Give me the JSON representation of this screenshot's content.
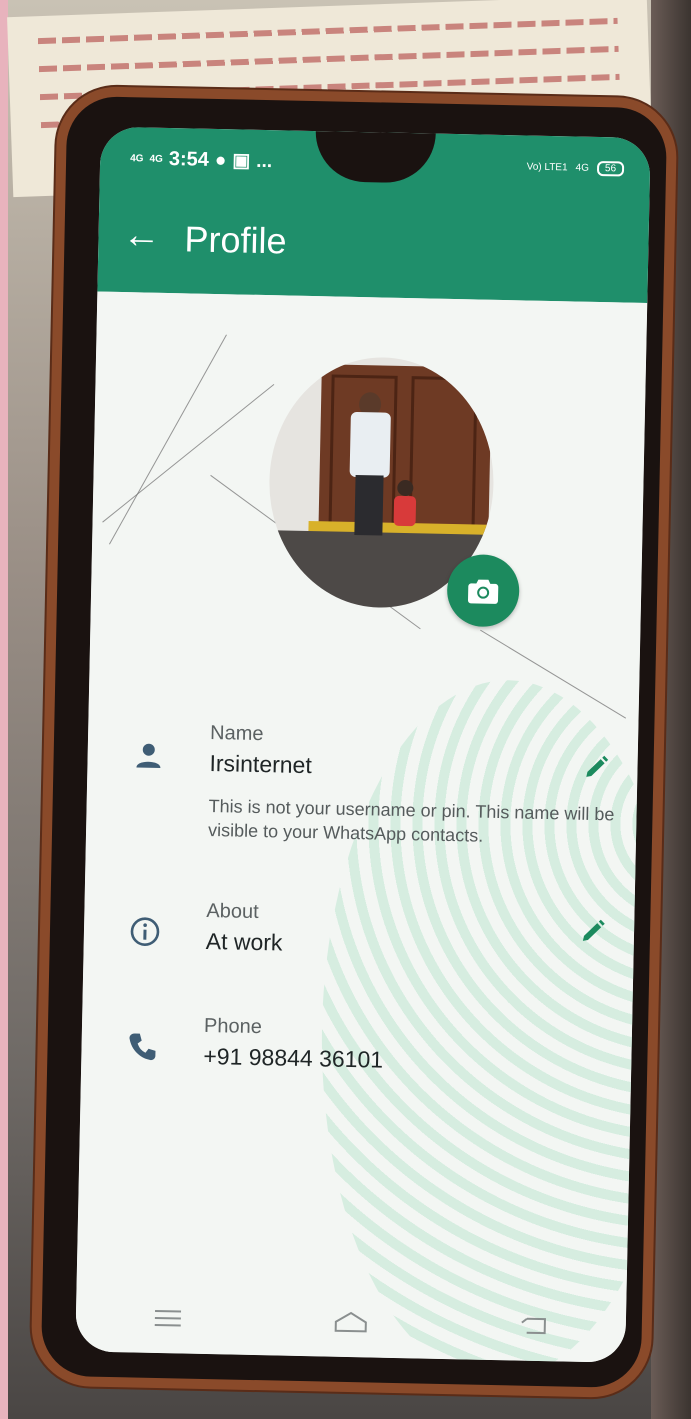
{
  "status_bar": {
    "network_left_1": "4G",
    "network_left_2": "4G",
    "time": "3:54",
    "dots": "...",
    "network_right_1": "Vo)",
    "network_right_2": "LTE1",
    "network_right_3": "4G",
    "battery": "56"
  },
  "app_bar": {
    "back_icon": "arrow-left-icon",
    "title": "Profile"
  },
  "profile": {
    "camera_icon": "camera-icon",
    "name_section": {
      "icon": "person-icon",
      "label": "Name",
      "value": "Irsinternet",
      "hint": "This is not your username or pin. This name will be visible to your WhatsApp contacts.",
      "edit_icon": "pencil-icon"
    },
    "about_section": {
      "icon": "info-icon",
      "label": "About",
      "value": "At work",
      "edit_icon": "pencil-icon"
    },
    "phone_section": {
      "icon": "phone-icon",
      "label": "Phone",
      "value": "+91 98844 36101"
    }
  },
  "nav_bar": {
    "menu_icon": "menu-icon",
    "home_icon": "home-icon",
    "back_icon": "back-icon"
  },
  "colors": {
    "app_bar": "#1f8f6b",
    "accent": "#1c8a5e",
    "icon": "#3f5d75"
  }
}
